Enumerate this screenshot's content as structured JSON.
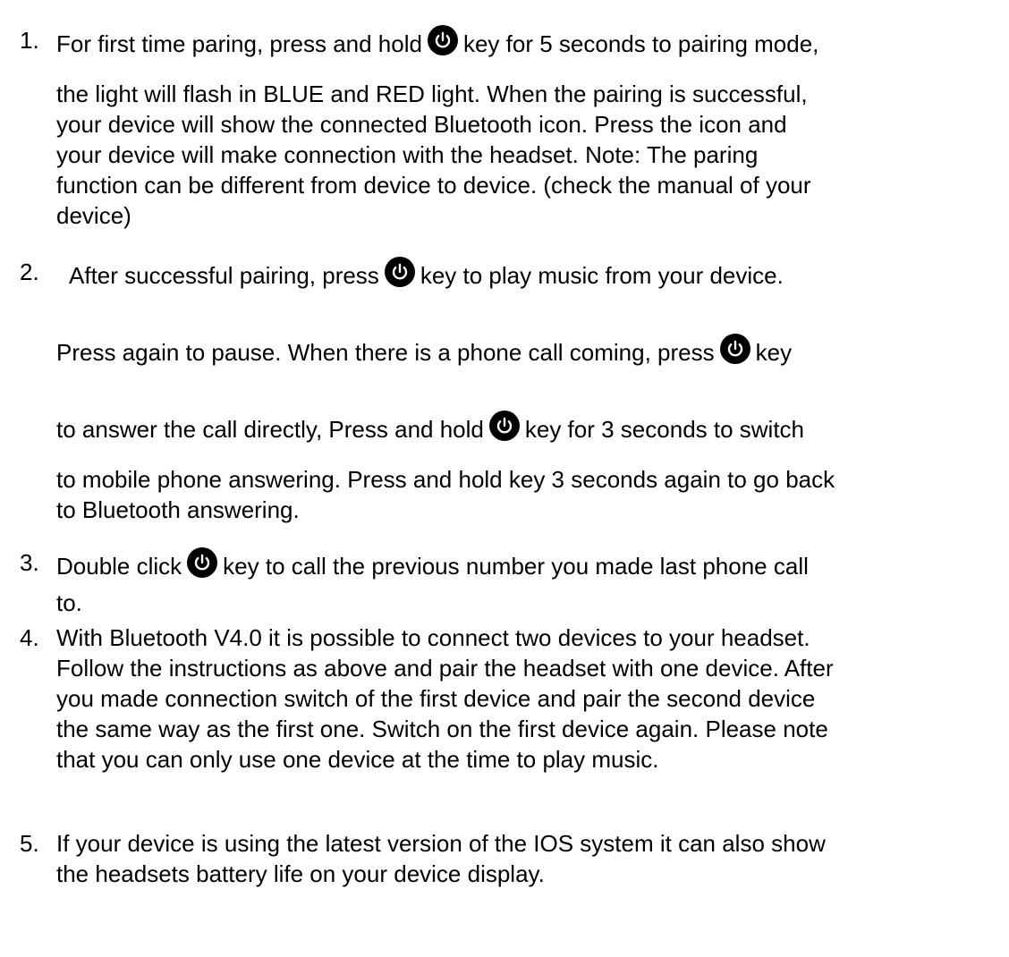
{
  "items": [
    {
      "number": "1.",
      "lines": [
        [
          "For first time paring, press and hold",
          "key for 5 seconds to pairing mode,"
        ],
        "the light will flash in BLUE and RED light. When the pairing is successful,",
        "your device will show the connected Bluetooth icon. Press the icon and",
        "your device will make connection with the headset. Note: The paring",
        "function can be different from device to device. (check the manual of your",
        "device)"
      ]
    },
    {
      "number": "2.",
      "lines": [
        [
          "After successful pairing, press",
          "key to play music from your device."
        ],
        [
          "Press again to pause. When there is a phone call coming, press",
          "key"
        ],
        [
          "to answer the call directly, Press and hold",
          "key for 3 seconds to switch"
        ],
        "to mobile phone answering. Press and hold key 3 seconds again to go back",
        "to Bluetooth answering."
      ]
    },
    {
      "number": "3.",
      "lines": [
        [
          "Double click",
          "key to call the previous number you made last phone call"
        ],
        "to."
      ]
    },
    {
      "number": "4.",
      "lines": [
        "With Bluetooth V4.0 it is possible to connect two devices to your headset.",
        "Follow the instructions as above and pair the headset with one device. After",
        "you made connection switch of the first device and pair the second device",
        "the same way as the first one. Switch on the first device again. Please note",
        "that you can only use one device at the time to play music."
      ]
    },
    {
      "number": "5.",
      "lines": [
        "If your device is using the latest version of the IOS system it can also show",
        "the headsets battery life on your device display."
      ]
    }
  ],
  "icon": "power-button-icon"
}
